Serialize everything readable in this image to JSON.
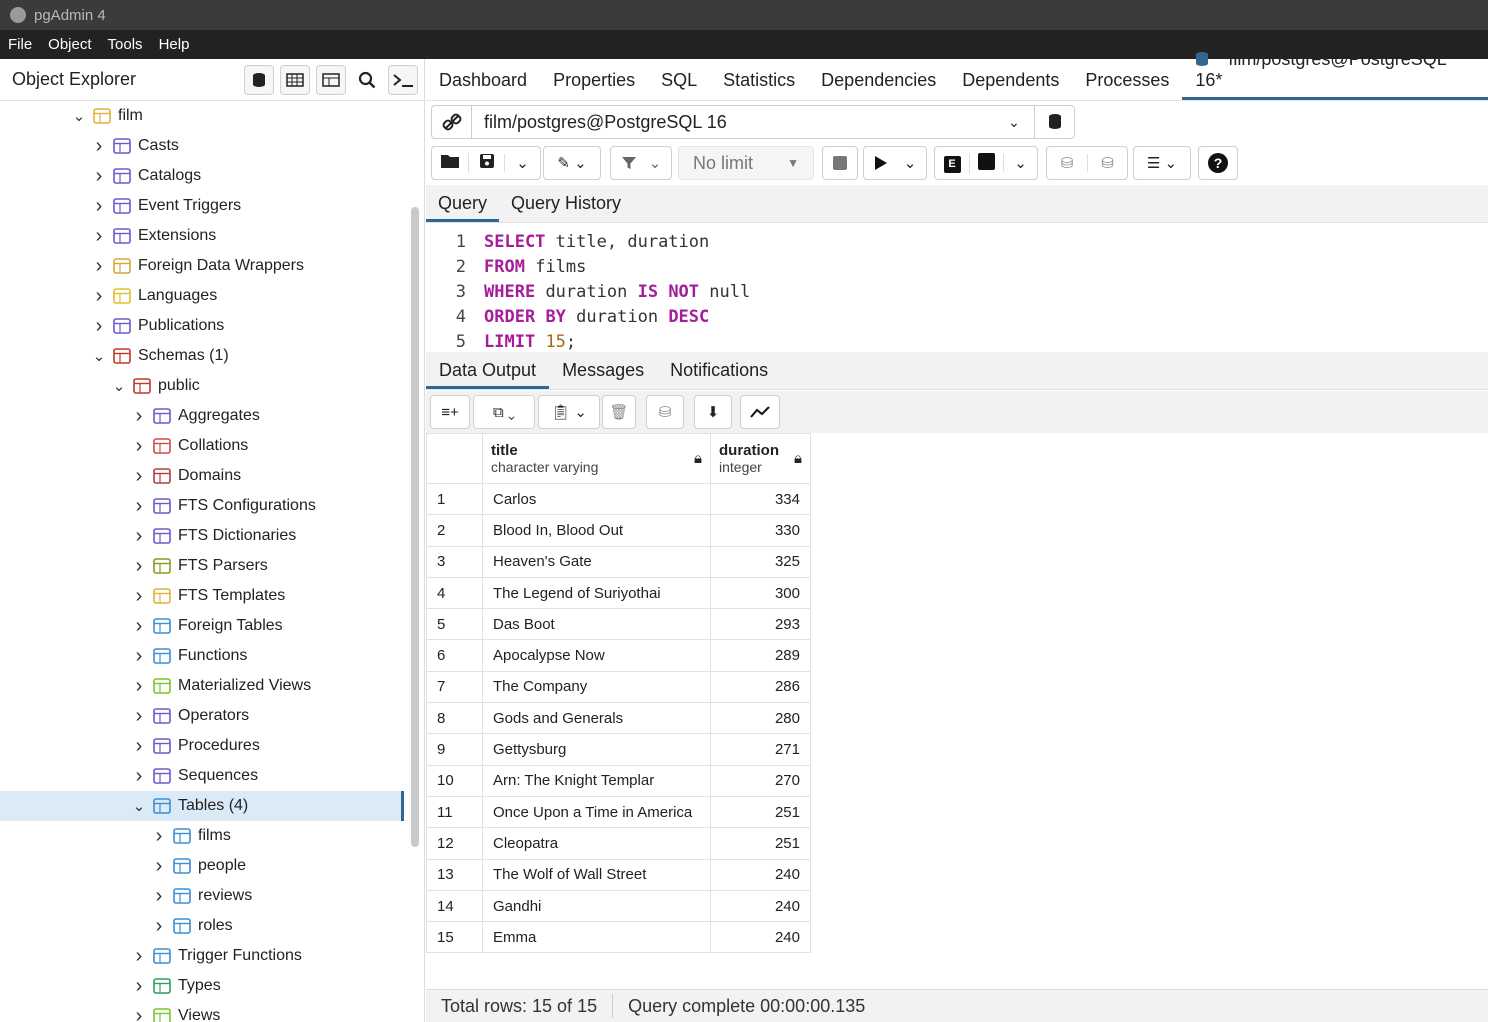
{
  "window": {
    "title": "pgAdmin 4"
  },
  "menu": [
    "File",
    "Object",
    "Tools",
    "Help"
  ],
  "explorer": {
    "title": "Object Explorer",
    "tree": [
      {
        "label": "film",
        "icon": "database-icon",
        "level": 0,
        "open": true
      },
      {
        "label": "Casts",
        "icon": "casts-icon",
        "level": 1
      },
      {
        "label": "Catalogs",
        "icon": "catalogs-icon",
        "level": 1
      },
      {
        "label": "Event Triggers",
        "icon": "event-triggers-icon",
        "level": 1
      },
      {
        "label": "Extensions",
        "icon": "extensions-icon",
        "level": 1
      },
      {
        "label": "Foreign Data Wrappers",
        "icon": "fdw-icon",
        "level": 1
      },
      {
        "label": "Languages",
        "icon": "languages-icon",
        "level": 1
      },
      {
        "label": "Publications",
        "icon": "publications-icon",
        "level": 1
      },
      {
        "label": "Schemas (1)",
        "icon": "schemas-icon",
        "level": 1,
        "open": true
      },
      {
        "label": "public",
        "icon": "schema-icon",
        "level": 2,
        "open": true
      },
      {
        "label": "Aggregates",
        "icon": "aggregates-icon",
        "level": 3
      },
      {
        "label": "Collations",
        "icon": "collations-icon",
        "level": 3
      },
      {
        "label": "Domains",
        "icon": "domains-icon",
        "level": 3
      },
      {
        "label": "FTS Configurations",
        "icon": "fts-config-icon",
        "level": 3
      },
      {
        "label": "FTS Dictionaries",
        "icon": "fts-dict-icon",
        "level": 3
      },
      {
        "label": "FTS Parsers",
        "icon": "fts-parser-icon",
        "level": 3
      },
      {
        "label": "FTS Templates",
        "icon": "fts-template-icon",
        "level": 3
      },
      {
        "label": "Foreign Tables",
        "icon": "foreign-table-icon",
        "level": 3
      },
      {
        "label": "Functions",
        "icon": "functions-icon",
        "level": 3
      },
      {
        "label": "Materialized Views",
        "icon": "mview-icon",
        "level": 3
      },
      {
        "label": "Operators",
        "icon": "operators-icon",
        "level": 3
      },
      {
        "label": "Procedures",
        "icon": "procedures-icon",
        "level": 3
      },
      {
        "label": "Sequences",
        "icon": "sequences-icon",
        "level": 3
      },
      {
        "label": "Tables (4)",
        "icon": "tables-icon",
        "level": 3,
        "open": true,
        "selected": true
      },
      {
        "label": "films",
        "icon": "table-icon",
        "level": 4
      },
      {
        "label": "people",
        "icon": "table-icon",
        "level": 4
      },
      {
        "label": "reviews",
        "icon": "table-icon",
        "level": 4
      },
      {
        "label": "roles",
        "icon": "table-icon",
        "level": 4
      },
      {
        "label": "Trigger Functions",
        "icon": "trigger-functions-icon",
        "level": 3
      },
      {
        "label": "Types",
        "icon": "types-icon",
        "level": 3
      },
      {
        "label": "Views",
        "icon": "views-icon",
        "level": 3
      }
    ]
  },
  "tabs": [
    "Dashboard",
    "Properties",
    "SQL",
    "Statistics",
    "Dependencies",
    "Dependents",
    "Processes"
  ],
  "active_tab": "film/postgres@PostgreSQL 16*",
  "connection": "film/postgres@PostgreSQL 16",
  "limit": "No limit",
  "query_tabs": [
    "Query",
    "Query History"
  ],
  "sql_lines": [
    "SELECT title, duration",
    "FROM films",
    "WHERE duration IS NOT null",
    "ORDER BY duration DESC",
    "LIMIT 15;"
  ],
  "output_tabs": [
    "Data Output",
    "Messages",
    "Notifications"
  ],
  "columns": [
    {
      "name": "title",
      "type": "character varying"
    },
    {
      "name": "duration",
      "type": "integer"
    }
  ],
  "rows": [
    [
      "1",
      "Carlos",
      "334"
    ],
    [
      "2",
      "Blood In, Blood Out",
      "330"
    ],
    [
      "3",
      "Heaven's Gate",
      "325"
    ],
    [
      "4",
      "The Legend of Suriyothai",
      "300"
    ],
    [
      "5",
      "Das Boot",
      "293"
    ],
    [
      "6",
      "Apocalypse Now",
      "289"
    ],
    [
      "7",
      "The Company",
      "286"
    ],
    [
      "8",
      "Gods and Generals",
      "280"
    ],
    [
      "9",
      "Gettysburg",
      "271"
    ],
    [
      "10",
      "Arn: The Knight Templar",
      "270"
    ],
    [
      "11",
      "Once Upon a Time in America",
      "251"
    ],
    [
      "12",
      "Cleopatra",
      "251"
    ],
    [
      "13",
      "The Wolf of Wall Street",
      "240"
    ],
    [
      "14",
      "Gandhi",
      "240"
    ],
    [
      "15",
      "Emma",
      "240"
    ]
  ],
  "status": {
    "total": "Total rows: 15 of 15",
    "time": "Query complete 00:00:00.135"
  },
  "colors": {
    "accent": "#326690",
    "keyword": "#a61d9a",
    "number": "#a26a14",
    "selection": "#dbeaf7"
  }
}
